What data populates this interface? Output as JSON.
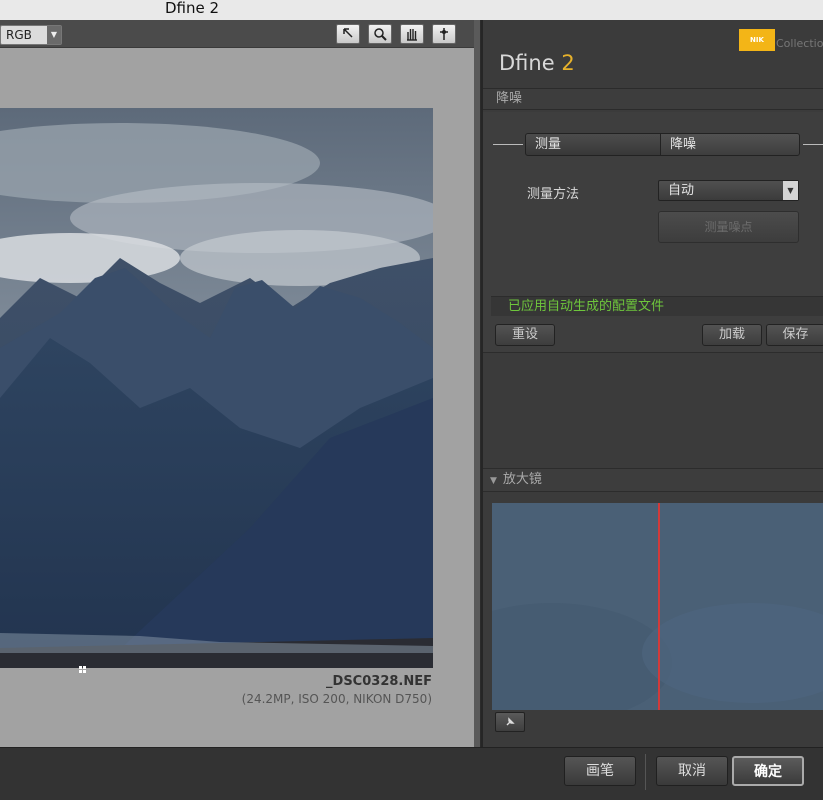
{
  "window": {
    "title": "Dfine 2"
  },
  "toolbar": {
    "channel_select": "RGB",
    "tools": [
      "arrow-pointer-icon",
      "zoom-icon",
      "hand-icon",
      "loupe-pin-icon"
    ]
  },
  "preview": {
    "filename": "_DSC0328.NEF",
    "fileinfo": "(24.2MP, ISO 200, NIKON D750)"
  },
  "panel": {
    "logo_text": "Collection",
    "app_name": "Dfine",
    "app_version": "2",
    "section_title": "降噪",
    "segments": {
      "measure": "测量",
      "reduce": "降噪"
    },
    "method_label": "测量方法",
    "method_value": "自动",
    "measure_button": "测量噪点",
    "status_text": "已应用自动生成的配置文件",
    "reset_button": "重设",
    "load_button": "加载",
    "save_button": "保存",
    "loupe_title": "放大镜"
  },
  "footer": {
    "brush_button": "画笔",
    "cancel_button": "取消",
    "ok_button": "确定"
  },
  "colors": {
    "accent_yellow": "#e7b22b",
    "status_green": "#6ec63c",
    "loupe_line": "#d23a3a"
  }
}
